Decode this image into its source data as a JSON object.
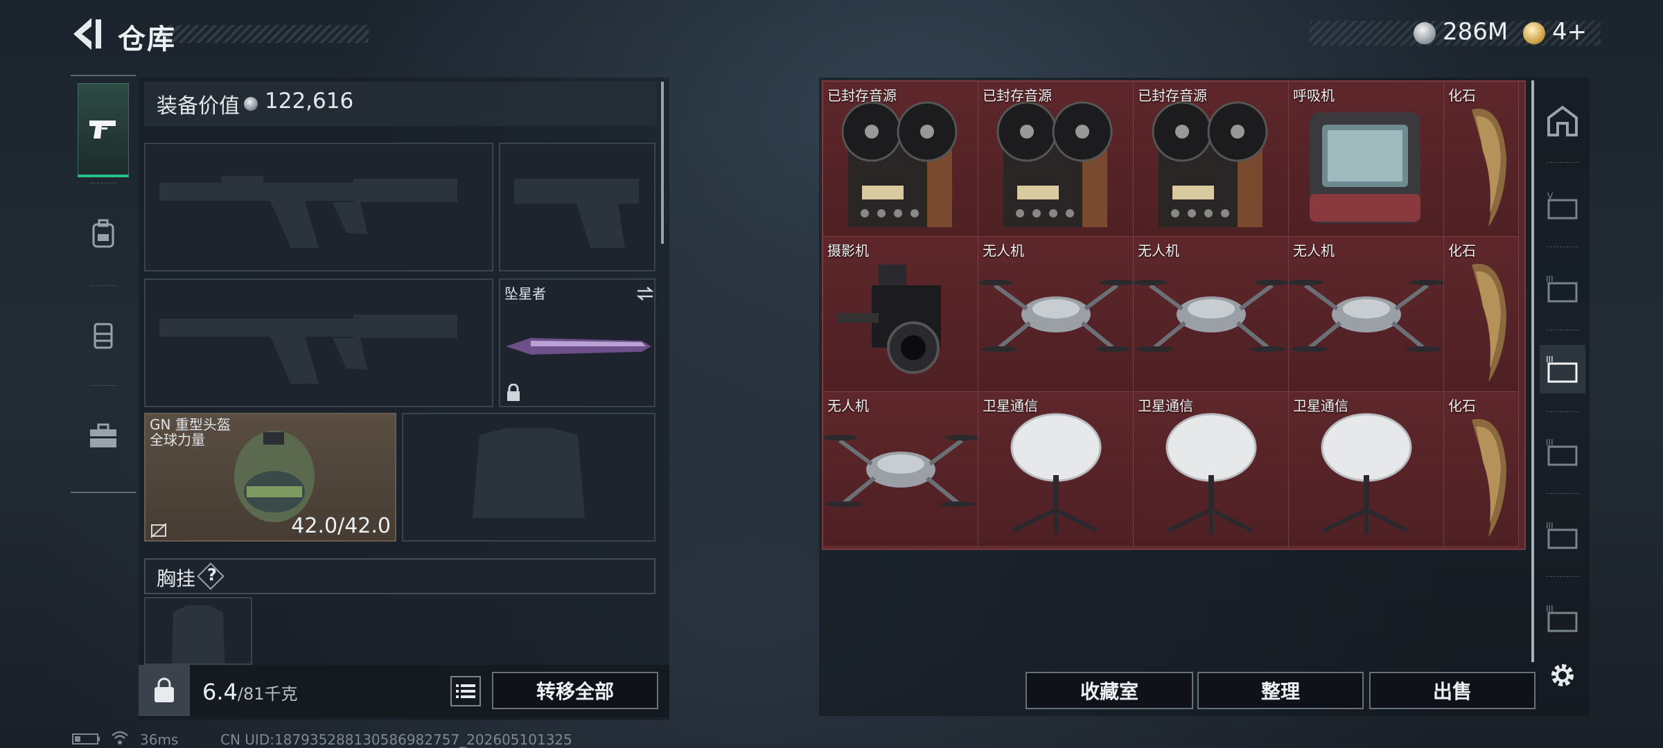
{
  "header": {
    "title": "仓库",
    "money": "286M",
    "gold": "4+"
  },
  "left_panel": {
    "value_label": "装备价值",
    "value": "122,616",
    "melee": {
      "name": "坠星者"
    },
    "helmet": {
      "name": "GN 重型头盔",
      "sub": "全球力量",
      "durability": "42.0/42.0"
    },
    "chest_label": "胸挂",
    "help": "?",
    "weight_current": "6.4",
    "weight_max": "/81千克",
    "transfer_all": "转移全部"
  },
  "stash": {
    "items": [
      {
        "name": "已封存音源",
        "icon": "reel-to-reel-icon"
      },
      {
        "name": "已封存音源",
        "icon": "reel-to-reel-icon"
      },
      {
        "name": "已封存音源",
        "icon": "reel-to-reel-icon"
      },
      {
        "name": "呼吸机",
        "icon": "ventilator-icon"
      },
      {
        "name": "化石",
        "icon": "fossil-claw-icon"
      },
      {
        "name": "摄影机",
        "icon": "film-camera-icon"
      },
      {
        "name": "无人机",
        "icon": "drone-icon"
      },
      {
        "name": "无人机",
        "icon": "drone-icon"
      },
      {
        "name": "无人机",
        "icon": "drone-icon"
      },
      {
        "name": "化石",
        "icon": "fossil-claw-icon"
      },
      {
        "name": "无人机",
        "icon": "drone-icon"
      },
      {
        "name": "卫星通信",
        "icon": "satellite-dish-icon"
      },
      {
        "name": "卫星通信",
        "icon": "satellite-dish-icon"
      },
      {
        "name": "卫星通信",
        "icon": "satellite-dish-icon"
      },
      {
        "name": "化石",
        "icon": "fossil-claw-icon"
      }
    ]
  },
  "actions": {
    "collection": "收藏室",
    "organize": "整理",
    "sell": "出售"
  },
  "status": {
    "ping": "36ms",
    "uid": "CN UID:18793528813058698275​7_202605101325"
  },
  "colors": {
    "accent": "#27c08a",
    "stash_bg": "#5a2629"
  }
}
